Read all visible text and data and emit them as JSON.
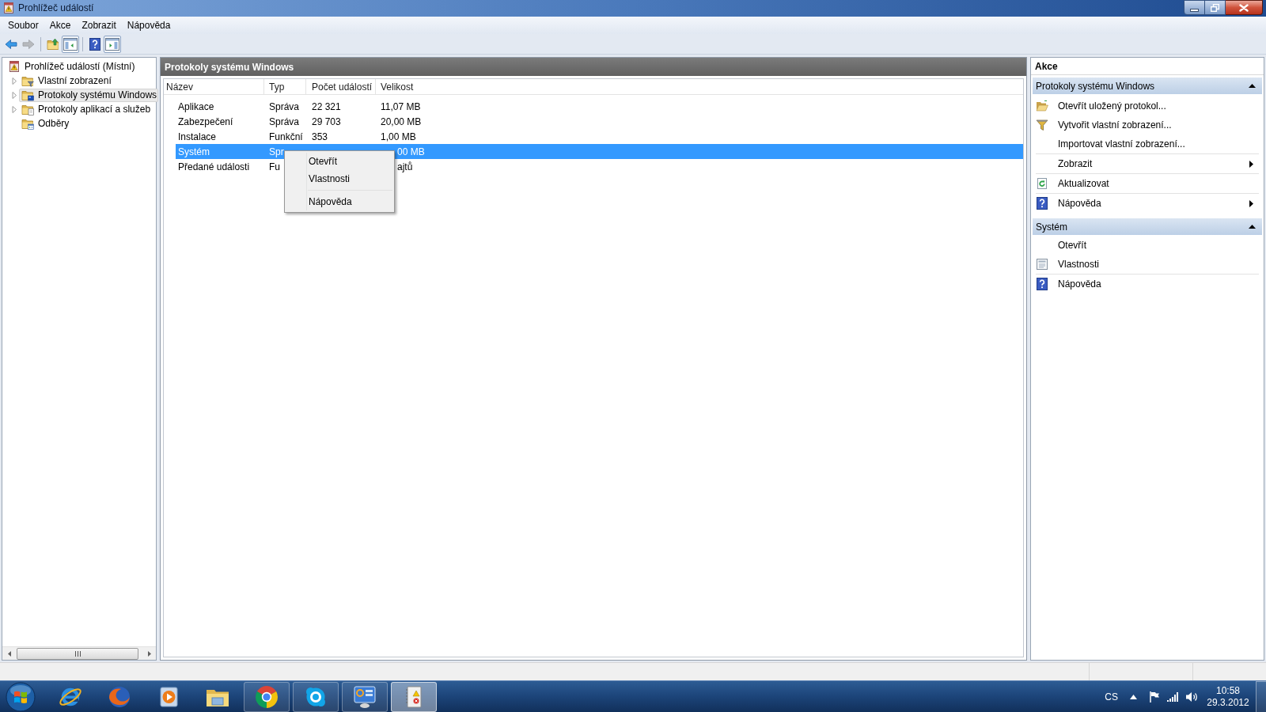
{
  "window": {
    "title": "Prohlížeč událostí"
  },
  "menu_bar": [
    "Soubor",
    "Akce",
    "Zobrazit",
    "Nápověda"
  ],
  "toolbar": {
    "groups": [
      {
        "buttons": [
          {
            "kind": "back",
            "disabled": false,
            "pressed": false
          },
          {
            "kind": "forward",
            "disabled": true,
            "pressed": false
          }
        ]
      },
      {
        "buttons": [
          {
            "kind": "up",
            "disabled": false,
            "pressed": false
          },
          {
            "kind": "tree",
            "disabled": false,
            "pressed": true
          }
        ]
      },
      {
        "buttons": [
          {
            "kind": "help",
            "disabled": false,
            "pressed": false
          },
          {
            "kind": "pane",
            "disabled": false,
            "pressed": true
          }
        ]
      }
    ]
  },
  "tree": {
    "items": [
      {
        "label": "Prohlížeč událostí (Místní)",
        "kind": "viewer",
        "expandable": false,
        "selected": false,
        "children": [
          {
            "label": "Vlastní zobrazení",
            "kind": "filter",
            "expandable": true,
            "selected": false
          },
          {
            "label": "Protokoly systému Windows",
            "kind": "windows",
            "expandable": true,
            "selected": true
          },
          {
            "label": "Protokoly aplikací a služeb",
            "kind": "apps",
            "expandable": true,
            "selected": false
          },
          {
            "label": "Odběry",
            "kind": "subscriptions",
            "expandable": false,
            "selected": false
          }
        ]
      }
    ]
  },
  "content": {
    "title": "Protokoly systému Windows",
    "columns": [
      "Název",
      "Typ",
      "Počet událostí",
      "Velikost"
    ],
    "rows": [
      {
        "name": "Aplikace",
        "type": "Správa",
        "count": "22 321",
        "size": "11,07 MB",
        "selected": false
      },
      {
        "name": "Zabezpečení",
        "type": "Správa",
        "count": "29 703",
        "size": "20,00 MB",
        "selected": false
      },
      {
        "name": "Instalace",
        "type": "Funkční",
        "count": "353",
        "size": "1,00 MB",
        "selected": false
      },
      {
        "name": "Systém",
        "type": "Spr",
        "size": "00 MB",
        "selected": true
      },
      {
        "name": "Předané události",
        "type": "Fu",
        "size": "ajtů",
        "selected": false
      }
    ]
  },
  "context_menu": {
    "items": [
      {
        "kind": "item",
        "label": "Otevřít"
      },
      {
        "kind": "item",
        "label": "Vlastnosti"
      },
      {
        "kind": "separator"
      },
      {
        "kind": "item",
        "label": "Nápověda"
      }
    ]
  },
  "actions": {
    "title": "Akce",
    "sections": [
      {
        "title": "Protokoly systému Windows",
        "expanded": true,
        "items": [
          {
            "kind": "open",
            "label": "Otevřít uložený protokol...",
            "submenu": false
          },
          {
            "kind": "filter",
            "label": "Vytvořit vlastní zobrazení...",
            "submenu": false
          },
          {
            "kind": "plain",
            "label": "Importovat vlastní zobrazení...",
            "submenu": false
          },
          {
            "kind": "separator"
          },
          {
            "kind": "plain",
            "label": "Zobrazit",
            "submenu": true
          },
          {
            "kind": "separator"
          },
          {
            "kind": "refresh",
            "label": "Aktualizovat",
            "submenu": false
          },
          {
            "kind": "separator"
          },
          {
            "kind": "help",
            "label": "Nápověda",
            "submenu": true
          }
        ]
      },
      {
        "title": "Systém",
        "expanded": true,
        "items": [
          {
            "kind": "plain",
            "label": "Otevřít",
            "submenu": false
          },
          {
            "kind": "properties",
            "label": "Vlastnosti",
            "submenu": false
          },
          {
            "kind": "separator"
          },
          {
            "kind": "help",
            "label": "Nápověda",
            "submenu": false
          }
        ]
      }
    ]
  },
  "taskbar": {
    "apps": [
      {
        "kind": "e-logo",
        "running": false,
        "active": false
      },
      {
        "kind": "fox",
        "running": false,
        "active": false
      },
      {
        "kind": "player",
        "running": false,
        "active": false
      },
      {
        "kind": "folder",
        "running": false,
        "active": false
      },
      {
        "kind": "wheel",
        "running": true,
        "active": false
      },
      {
        "kind": "cloud",
        "running": true,
        "active": false
      },
      {
        "kind": "dashboard",
        "running": true,
        "active": false
      },
      {
        "kind": "log",
        "running": true,
        "active": true
      }
    ],
    "tray": {
      "language": "CS",
      "time": "10:58",
      "date": "29.3.2012"
    }
  }
}
